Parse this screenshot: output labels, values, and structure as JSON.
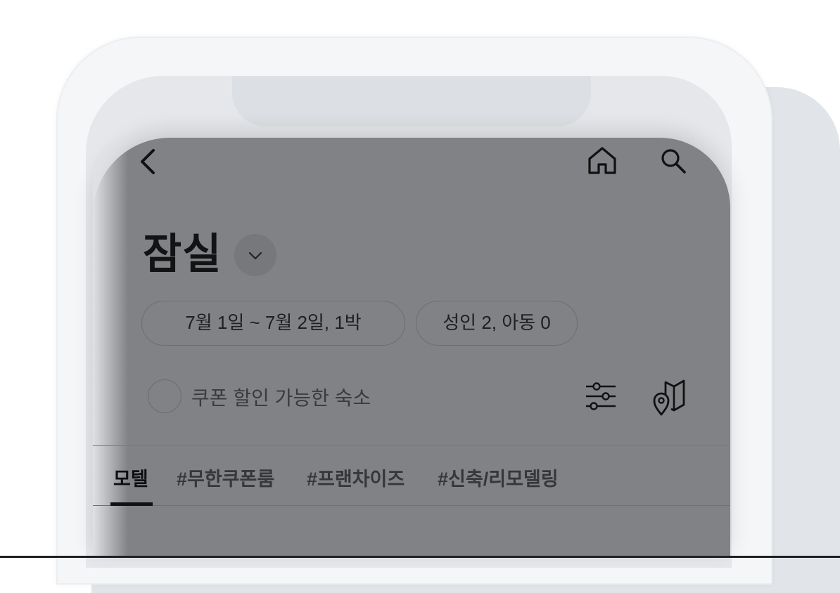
{
  "header": {
    "back_icon": "chevron-left-icon",
    "home_icon": "home-icon",
    "search_icon": "search-icon"
  },
  "location": {
    "title": "잠실",
    "dropdown_icon": "chevron-down-icon"
  },
  "filters": {
    "date_range": "7월 1일 ~ 7월 2일, 1박",
    "guests": "성인 2, 아동 0"
  },
  "coupon": {
    "label": "쿠폰 할인 가능한 숙소",
    "checked": false
  },
  "tools": {
    "filter_icon": "sliders-icon",
    "map_icon": "map-pin-icon"
  },
  "tabs": [
    {
      "label": "모텔",
      "active": true
    },
    {
      "label": "#무한쿠폰룸",
      "active": false
    },
    {
      "label": "#프랜차이즈",
      "active": false
    },
    {
      "label": "#신축/리모델링",
      "active": false
    }
  ],
  "colors": {
    "overlay": "#808285",
    "text_primary": "#121314",
    "page_bg": "#ffffff"
  }
}
